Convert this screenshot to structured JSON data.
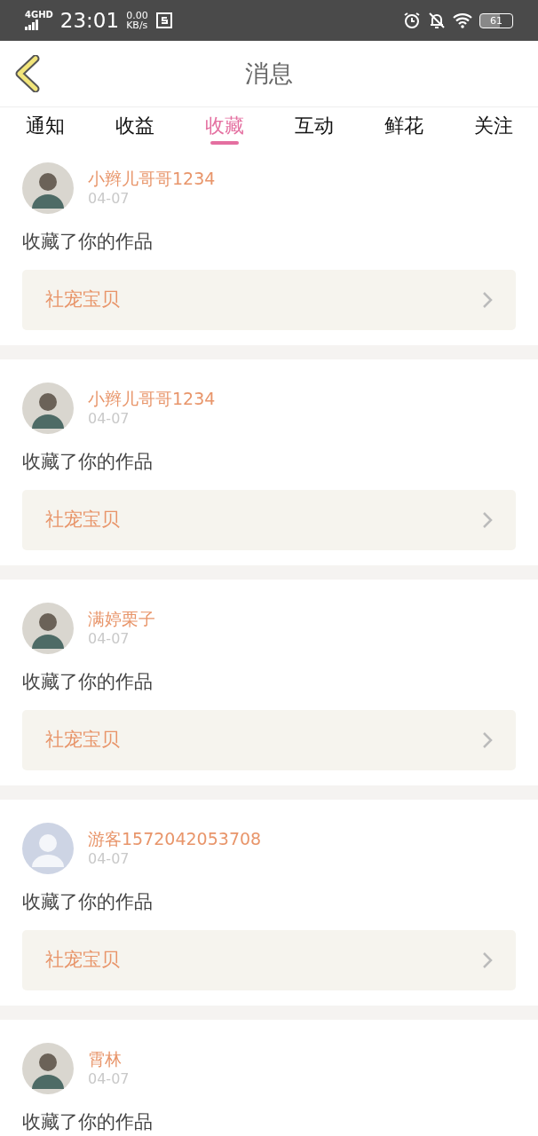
{
  "status_bar": {
    "network": "4G",
    "network_extra": "HD",
    "time": "23:01",
    "speed": "0.00",
    "speed_unit": "KB/s",
    "battery": "61"
  },
  "header": {
    "title": "消息"
  },
  "tabs": [
    {
      "label": "通知",
      "selected": false
    },
    {
      "label": "收益",
      "selected": false
    },
    {
      "label": "收藏",
      "selected": true
    },
    {
      "label": "互动",
      "selected": false
    },
    {
      "label": "鲜花",
      "selected": false
    },
    {
      "label": "关注",
      "selected": false
    }
  ],
  "messages": [
    {
      "user": "小辫儿哥哥1234",
      "default_avatar": false,
      "date": "04-07",
      "action": "收藏了你的作品",
      "work": "社宠宝贝"
    },
    {
      "user": "小辫儿哥哥1234",
      "default_avatar": false,
      "date": "04-07",
      "action": "收藏了你的作品",
      "work": "社宠宝贝"
    },
    {
      "user": "满婷栗子",
      "default_avatar": false,
      "date": "04-07",
      "action": "收藏了你的作品",
      "work": "社宠宝贝"
    },
    {
      "user": "游客1572042053708",
      "default_avatar": true,
      "date": "04-07",
      "action": "收藏了你的作品",
      "work": "社宠宝贝"
    },
    {
      "user": "霄林",
      "default_avatar": false,
      "date": "04-07",
      "action": "收藏了你的作品"
    }
  ]
}
